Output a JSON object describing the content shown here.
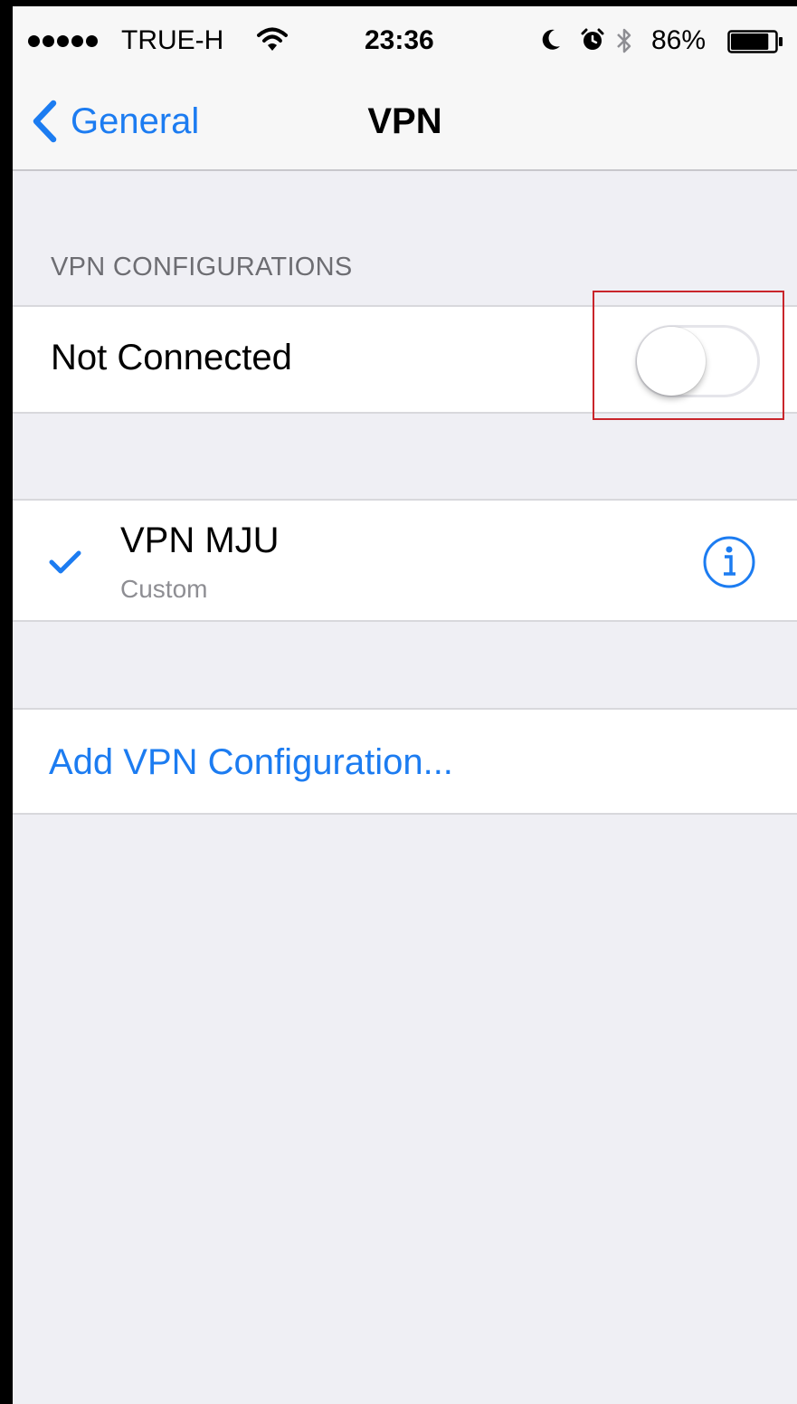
{
  "status_bar": {
    "carrier": "TRUE-H",
    "time": "23:36",
    "battery_percent": "86%",
    "battery_level": 0.86,
    "signal_bars": 5
  },
  "nav": {
    "back_label": "General",
    "title": "VPN"
  },
  "section": {
    "header": "VPN CONFIGURATIONS"
  },
  "status_row": {
    "label": "Not Connected",
    "toggle_on": false
  },
  "vpn_item": {
    "name": "VPN MJU",
    "type": "Custom",
    "selected": true
  },
  "add_vpn": {
    "label": "Add VPN Configuration..."
  },
  "colors": {
    "accent": "#1c7cf1",
    "background": "#efeff4",
    "highlight": "#c9252b"
  },
  "icons": [
    "wifi-icon",
    "moon-icon",
    "alarm-icon",
    "bluetooth-icon",
    "battery-icon",
    "back-chevron-icon",
    "checkmark-icon",
    "info-icon"
  ]
}
